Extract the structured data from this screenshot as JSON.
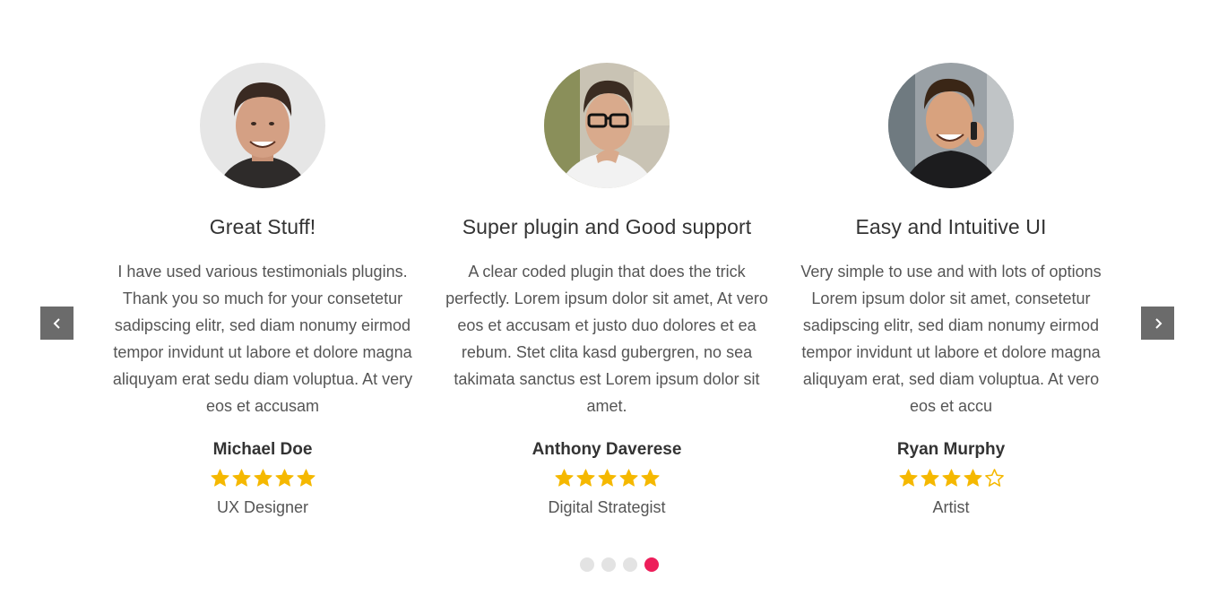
{
  "colors": {
    "star": "#f5b800",
    "dot_active": "#ed1e5a",
    "dot_inactive": "#e3e3e3",
    "nav_bg": "#6b6b6b"
  },
  "navigation": {
    "prev_icon": "chevron-left-icon",
    "next_icon": "chevron-right-icon"
  },
  "testimonials": [
    {
      "title": "Great Stuff!",
      "text": "I have used various testimonials plugins. Thank you so much for your consetetur sadipscing elitr, sed diam nonumy eirmod tempor invidunt ut labore et dolore magna aliquyam erat sedu diam voluptua. At very eos et accusam",
      "name": "Michael Doe",
      "role": "UX Designer",
      "rating": 5
    },
    {
      "title": "Super plugin and Good support",
      "text": "A clear coded plugin that does the trick perfectly. Lorem ipsum dolor sit amet, At vero eos et accusam et justo duo dolores et ea rebum. Stet clita kasd gubergren, no sea takimata sanctus est Lorem ipsum dolor sit amet.",
      "name": "Anthony Daverese",
      "role": "Digital Strategist",
      "rating": 5
    },
    {
      "title": "Easy and Intuitive UI",
      "text": "Very simple to use and with lots of options Lorem ipsum dolor sit amet, consetetur sadipscing elitr, sed diam nonumy eirmod tempor invidunt ut labore et dolore magna aliquyam erat, sed diam voluptua. At vero eos et accu",
      "name": "Ryan Murphy",
      "role": "Artist",
      "rating": 4
    }
  ],
  "pagination": {
    "count": 4,
    "active_index": 3
  }
}
